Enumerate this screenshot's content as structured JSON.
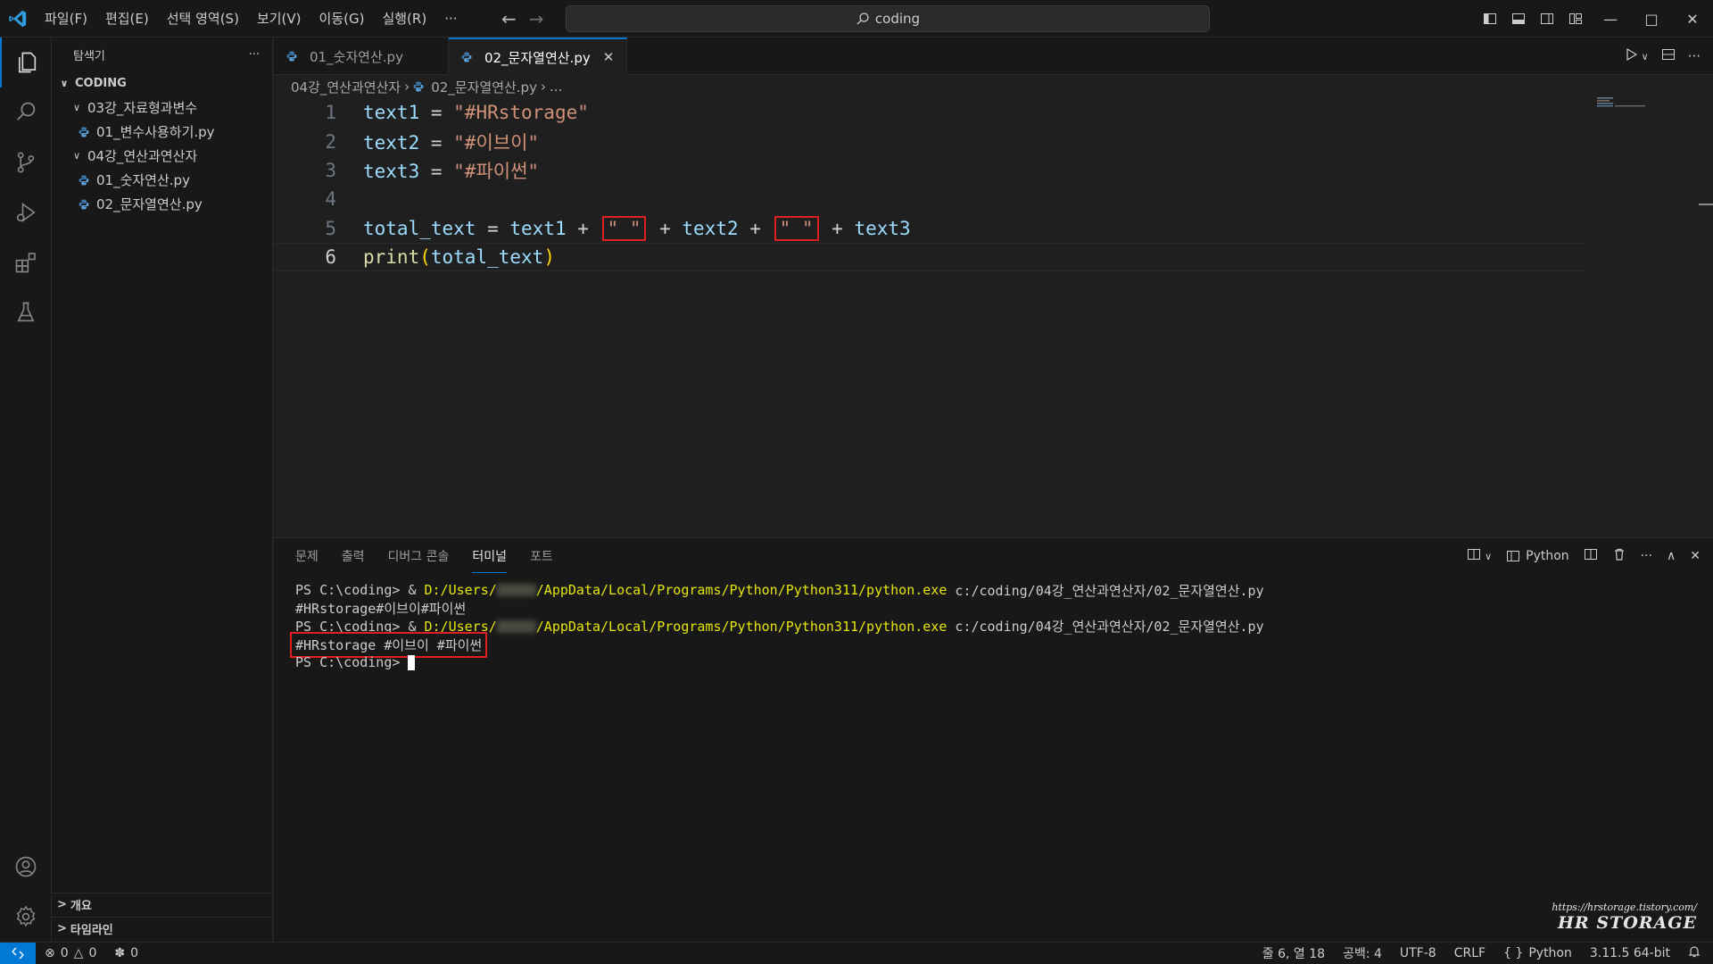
{
  "menu": [
    "파일(F)",
    "편집(E)",
    "선택 영역(S)",
    "보기(V)",
    "이동(G)",
    "실행(R)"
  ],
  "menu_more": "···",
  "search": {
    "text": "coding"
  },
  "sidebar": {
    "title": "탐색기",
    "more": "···",
    "root": "CODING",
    "items": [
      {
        "label": "03강_자료형과변수",
        "type": "folder"
      },
      {
        "label": "01_변수사용하기.py",
        "type": "file"
      },
      {
        "label": "04강_연산과연산자",
        "type": "folder"
      },
      {
        "label": "01_숫자연산.py",
        "type": "file"
      },
      {
        "label": "02_문자열연산.py",
        "type": "file"
      }
    ],
    "outline": "개요",
    "timeline": "타임라인"
  },
  "tabs": [
    {
      "label": "01_숫자연산.py",
      "active": false
    },
    {
      "label": "02_문자열연산.py",
      "active": true
    }
  ],
  "breadcrumb": {
    "folder": "04강_연산과연산자",
    "file": "02_문자열연산.py",
    "tail": "..."
  },
  "code": {
    "line_numbers": [
      "1",
      "2",
      "3",
      "4",
      "5",
      "6"
    ],
    "l1_var": "text1",
    "l1_eq": " = ",
    "l1_str": "\"#HRstorage\"",
    "l2_var": "text2",
    "l2_eq": " = ",
    "l2_str": "\"#이브이\"",
    "l3_var": "text3",
    "l3_eq": " = ",
    "l3_str": "\"#파이썬\"",
    "l5_a": "total_text",
    "l5_b": " = ",
    "l5_c": "text1",
    "l5_d": " + ",
    "l5_s1": "\" \"",
    "l5_e": " + ",
    "l5_f": "text2",
    "l5_g": " + ",
    "l5_s2": "\" \"",
    "l5_h": " + ",
    "l5_i": "text3",
    "l6_fn": "print",
    "l6_open": "(",
    "l6_arg": "total_text",
    "l6_close": ")"
  },
  "panel": {
    "tabs": [
      "문제",
      "출력",
      "디버그 콘솔",
      "터미널",
      "포트"
    ],
    "active_tab": "터미널",
    "shell_label": "Python"
  },
  "terminal": {
    "prompt": "PS C:\\coding> ",
    "amp": "& ",
    "path_a": "D:/Users/",
    "path_b": "/AppData/Local/Programs/Python/Python311/python.exe",
    "script": " c:/coding/04강_연산과연산자/02_문자열연산.py",
    "out1": "#HRstorage#이브이#파이썬",
    "out2": "#HRstorage #이브이 #파이썬"
  },
  "watermark": {
    "url": "https://hrstorage.tistory.com/",
    "name": "HR STORAGE"
  },
  "status": {
    "errors": "0",
    "warnings": "0",
    "ports": "0",
    "position": "줄 6, 열 18",
    "spaces": "공백: 4",
    "encoding": "UTF-8",
    "eol": "CRLF",
    "language": "Python",
    "interpreter": "3.11.5 64-bit"
  },
  "colors": {
    "accent": "#0078d4",
    "highlight_box": "#e02020",
    "string": "#ce9178",
    "variable": "#9cdcfe",
    "function": "#dcdcaa"
  }
}
